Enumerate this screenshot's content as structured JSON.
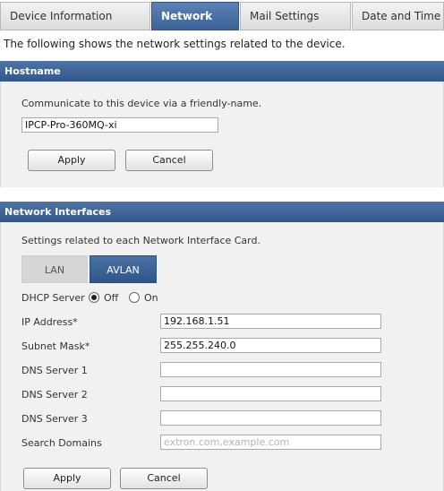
{
  "tabs": {
    "device_information": "Device Information",
    "network": "Network",
    "mail_settings": "Mail Settings",
    "date_and_time": "Date and Time"
  },
  "intro_text": "The following shows the network settings related to the device.",
  "hostname": {
    "header": "Hostname",
    "description": "Communicate to this device via a friendly-name.",
    "value": "IPCP-Pro-360MQ-xi",
    "apply_label": "Apply",
    "cancel_label": "Cancel"
  },
  "network_interfaces": {
    "header": "Network Interfaces",
    "description": "Settings related to each Network Interface Card.",
    "nic_tabs": {
      "lan": "LAN",
      "avlan": "AVLAN"
    },
    "dhcp": {
      "label": "DHCP Server",
      "off_label": "Off",
      "on_label": "On",
      "selected": "Off"
    },
    "fields": {
      "ip_address": {
        "label": "IP Address*",
        "value": "192.168.1.51"
      },
      "subnet_mask": {
        "label": "Subnet Mask*",
        "value": "255.255.240.0"
      },
      "dns1": {
        "label": "DNS Server 1",
        "value": ""
      },
      "dns2": {
        "label": "DNS Server 2",
        "value": ""
      },
      "dns3": {
        "label": "DNS Server 3",
        "value": ""
      },
      "search_domains": {
        "label": "Search Domains",
        "value": "",
        "placeholder": "extron.com,example.com"
      }
    },
    "apply_label": "Apply",
    "cancel_label": "Cancel"
  },
  "colors": {
    "accent": "#3c6398",
    "section_header": "#31578c",
    "panel_bg": "#f1f1f1"
  }
}
